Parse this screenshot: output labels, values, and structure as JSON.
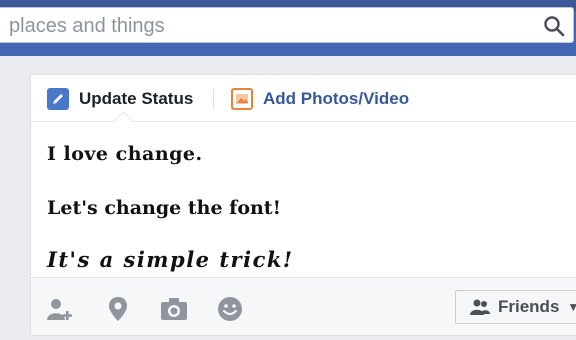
{
  "search": {
    "placeholder": "places and things"
  },
  "composer": {
    "tabs": [
      {
        "label": "Update Status",
        "icon": "pencil-icon"
      },
      {
        "label": "Add Photos/Video",
        "icon": "photo-icon"
      }
    ],
    "lines": [
      "I love change.",
      "Let's change the font!",
      "It's a simple trick!"
    ],
    "actions": [
      "tag-people-icon",
      "location-pin-icon",
      "camera-icon",
      "emoji-icon"
    ],
    "audience": {
      "label": "Friends",
      "icon": "friends-icon",
      "caret": "▼"
    }
  },
  "colors": {
    "header": "#4267b2",
    "link": "#365899",
    "photo_accent": "#e8823a",
    "icon_gray": "#90949c"
  }
}
